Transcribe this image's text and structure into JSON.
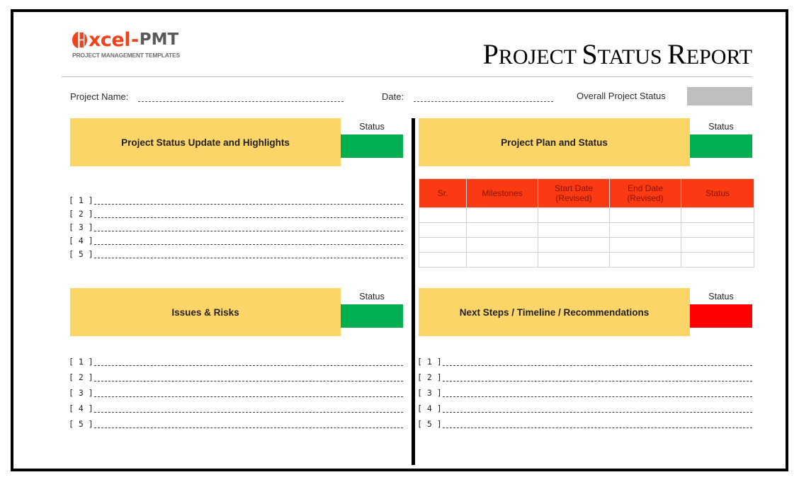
{
  "brand": {
    "wordmark_xcel": "xcel",
    "wordmark_dash": "-",
    "wordmark_pmt": "PMT",
    "tagline": "PROJECT MANAGEMENT TEMPLATES",
    "logo_color": "#F0421B",
    "pmt_color": "#58595B"
  },
  "header": {
    "title_words": [
      {
        "initial": "P",
        "rest": "ROJECT"
      },
      {
        "initial": "S",
        "rest": "TATUS"
      },
      {
        "initial": "R",
        "rest": "EPORT"
      }
    ],
    "title_plain": "Project Status Report"
  },
  "meta": {
    "project_name_label": "Project Name:",
    "project_name_value": "",
    "date_label": "Date:",
    "date_value": "",
    "overall_status_label": "Overall Project Status",
    "overall_status_value": "",
    "overall_status_color": "#bfbfbf"
  },
  "colors": {
    "panel_yellow": "#FBD567",
    "status_green": "#00AF50",
    "status_red": "#FF0000",
    "table_header": "#F93A12",
    "table_header_text": "#8C1200",
    "divider_black": "#000000"
  },
  "status_label": "Status",
  "panels": {
    "status_update": {
      "title": "Project Status Update and Highlights",
      "status_label": "Status",
      "status_color": "#00AF50",
      "status_value": "Green"
    },
    "project_plan": {
      "title": "Project Plan and Status",
      "status_label": "Status",
      "status_color": "#00AF50",
      "status_value": "Green"
    },
    "issues_risks": {
      "title": "Issues & Risks",
      "status_label": "Status",
      "status_color": "#00AF50",
      "status_value": "Green"
    },
    "next_steps": {
      "title": "Next Steps / Timeline / Recommendations",
      "status_label": "Status",
      "status_color": "#FF0000",
      "status_value": "Red"
    }
  },
  "lists": {
    "status_update_items": [
      "[ 1 ]",
      "[ 2 ]",
      "[ 3 ]",
      "[ 4 ]",
      "[ 5 ]"
    ],
    "issues_risks_items": [
      "[ 1 ]",
      "[ 2 ]",
      "[ 3 ]",
      "[ 4 ]",
      "[ 5 ]"
    ],
    "next_steps_items": [
      "[ 1 ]",
      "[ 2 ]",
      "[ 3 ]",
      "[ 4 ]",
      "[ 5 ]"
    ]
  },
  "milestone_table": {
    "columns": [
      "Sr.",
      "Milestones",
      "Start Date\n(Revised)",
      "End Date\n(Revised)",
      "Status"
    ],
    "columns_split": [
      {
        "line1": "Sr.",
        "line2": ""
      },
      {
        "line1": "Milestones",
        "line2": ""
      },
      {
        "line1": "Start Date",
        "line2": "(Revised)"
      },
      {
        "line1": "End Date",
        "line2": "(Revised)"
      },
      {
        "line1": "Status",
        "line2": ""
      }
    ],
    "rows": [
      [
        "",
        "",
        "",
        "",
        ""
      ],
      [
        "",
        "",
        "",
        "",
        ""
      ],
      [
        "",
        "",
        "",
        "",
        ""
      ],
      [
        "",
        "",
        "",
        "",
        ""
      ]
    ]
  }
}
